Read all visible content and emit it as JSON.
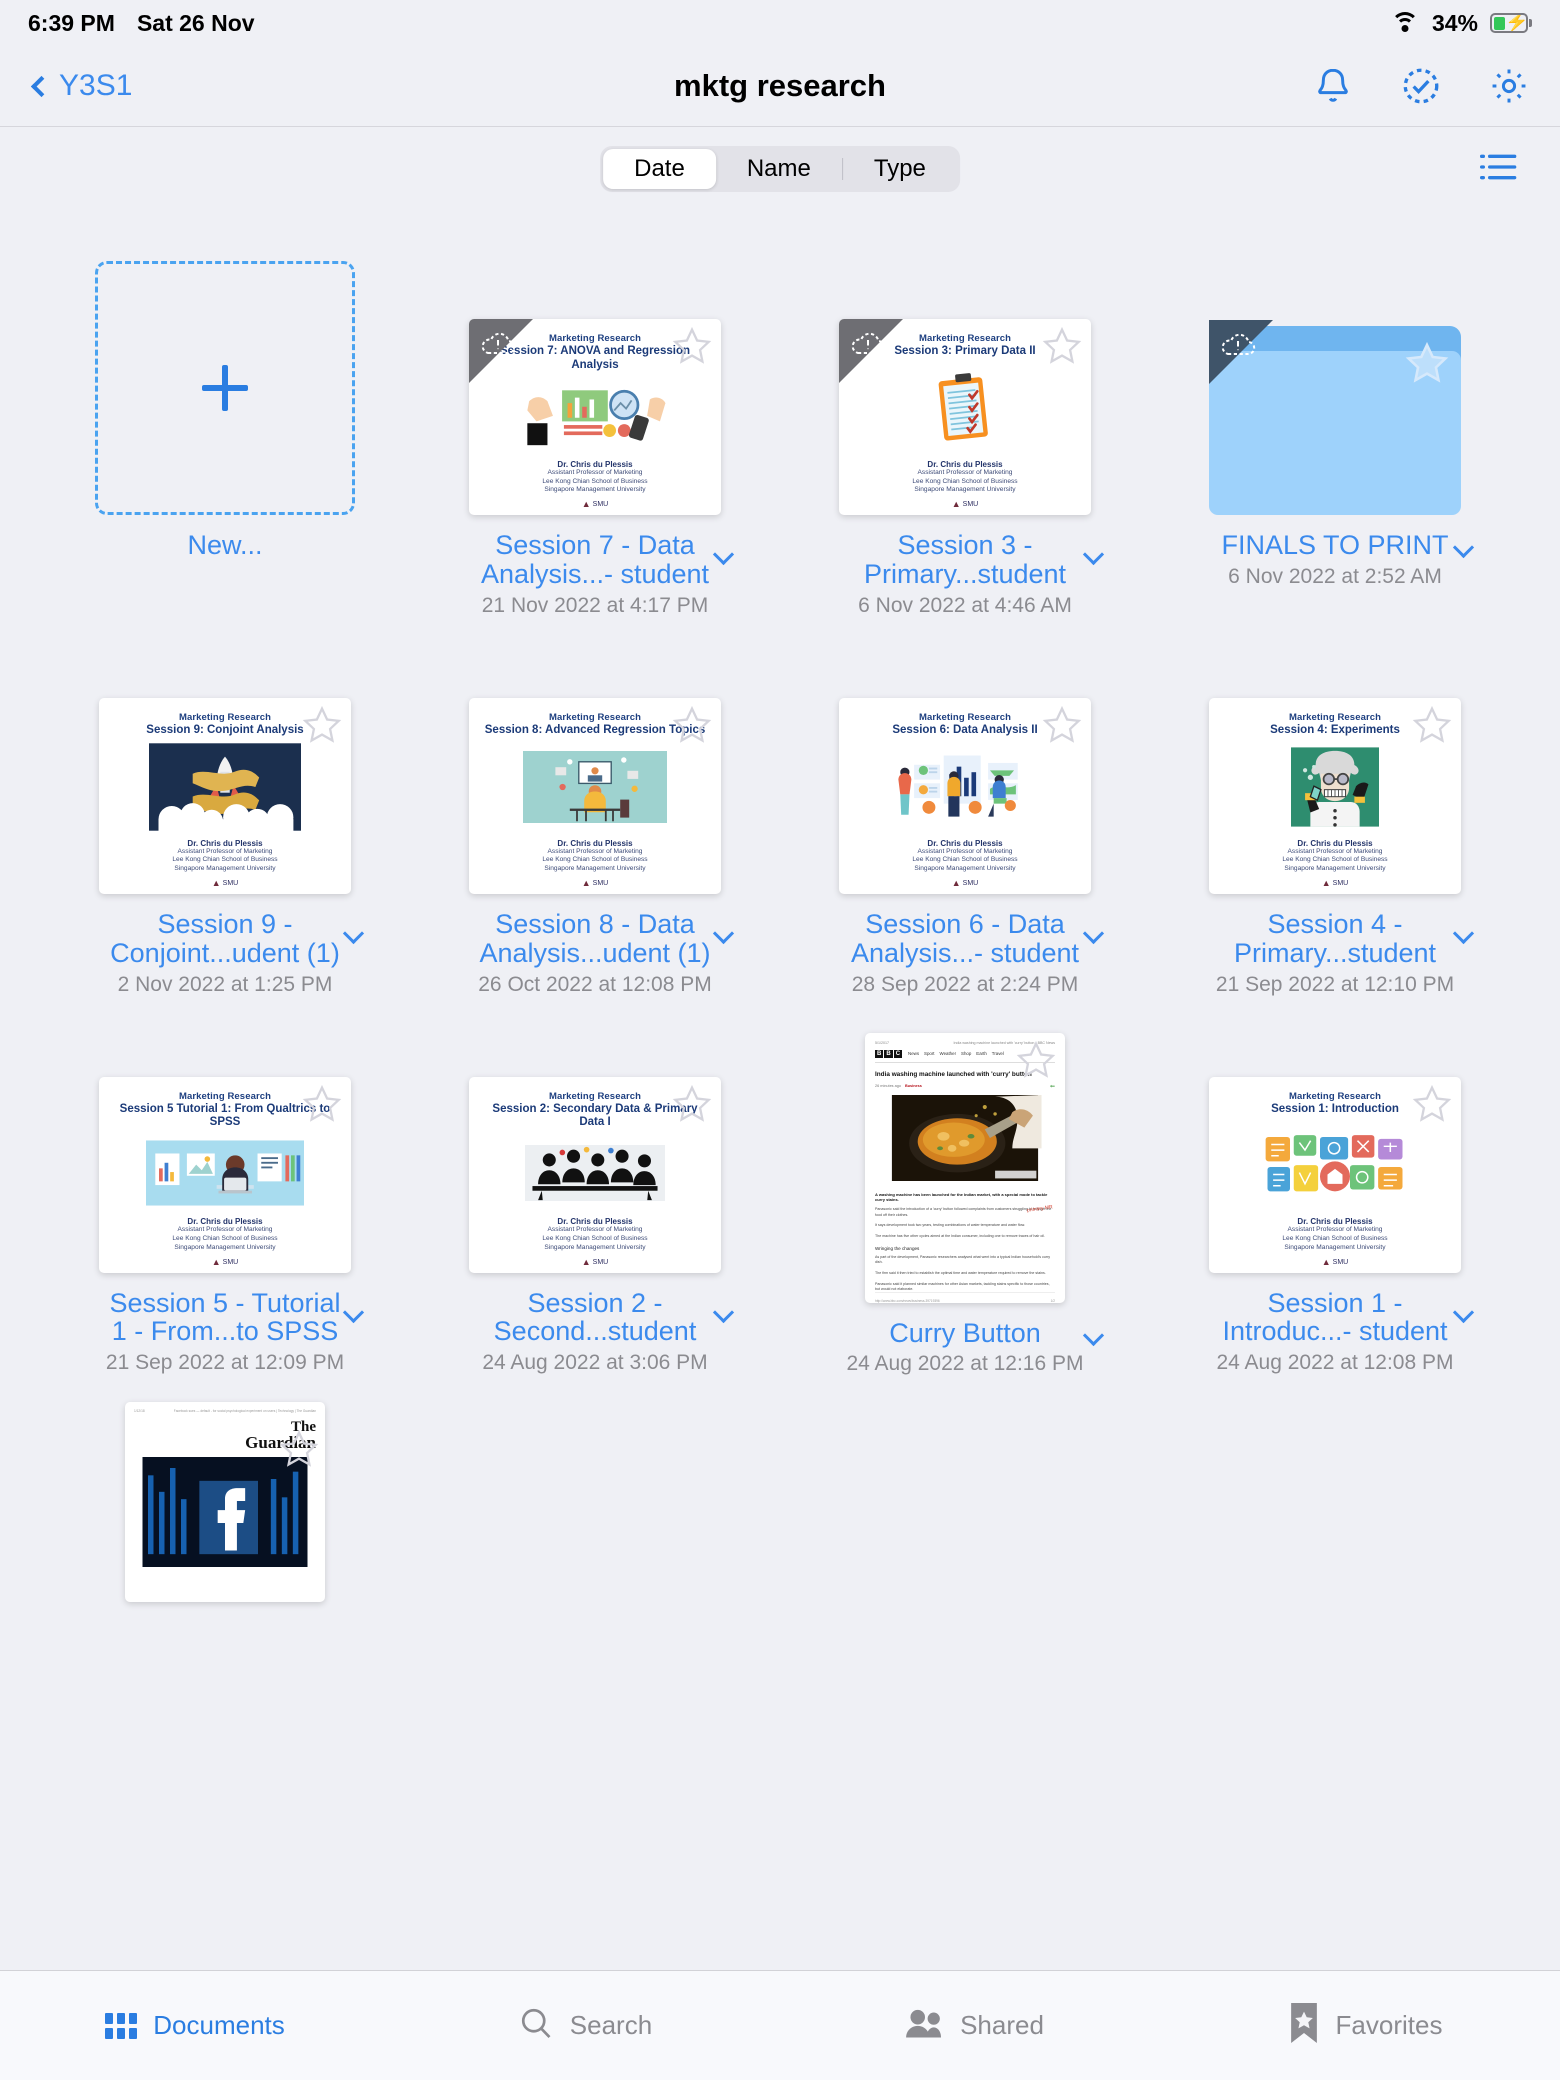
{
  "status_bar": {
    "time": "6:39 PM",
    "date": "Sat 26 Nov",
    "battery_percent": "34%",
    "wifi_icon": "wifi-icon",
    "battery_icon": "battery-charging-icon"
  },
  "nav": {
    "back_label": "Y3S1",
    "title": "mktg research",
    "actions": [
      {
        "name": "notifications-bell-icon",
        "label": "bell-icon"
      },
      {
        "name": "select-items-icon",
        "label": "dashed-circle-check-icon"
      },
      {
        "name": "settings-gear-icon",
        "label": "gear-icon"
      }
    ]
  },
  "toolbar": {
    "sort_options": [
      {
        "label": "Date",
        "selected": true
      },
      {
        "label": "Name",
        "selected": false
      },
      {
        "label": "Type",
        "selected": false
      }
    ],
    "view_toggle_icon": "list-view-icon"
  },
  "new_tile": {
    "label": "New...",
    "icon": "plus-icon"
  },
  "items": [
    {
      "name": "Session 7 - Data Analysis...- student",
      "date": "21 Nov 2022 at 4:17 PM",
      "kind": "presentation",
      "badge": "cloud-download-icon",
      "slide": {
        "subtitle": "Marketing Research",
        "title": "Session 7: ANOVA and Regression Analysis",
        "author": "Dr. Chris du Plessis",
        "affiliation_1": "Assistant Professor of Marketing",
        "affiliation_2": "Lee Kong Chian School of Business",
        "affiliation_3": "Singapore Management University",
        "logo": "SMU"
      }
    },
    {
      "name": "Session 3 - Primary...student",
      "date": "6 Nov 2022 at 4:46 AM",
      "kind": "presentation",
      "badge": "cloud-download-icon",
      "slide": {
        "subtitle": "Marketing Research",
        "title": "Session 3: Primary Data II",
        "author": "Dr. Chris du Plessis",
        "affiliation_1": "Assistant Professor of Marketing",
        "affiliation_2": "Lee Kong Chian School of Business",
        "affiliation_3": "Singapore Management University",
        "logo": "SMU"
      }
    },
    {
      "name": "FINALS TO PRINT",
      "date": "6 Nov 2022 at 2:52 AM",
      "kind": "folder",
      "badge": "cloud-download-icon"
    },
    {
      "name": "Session 9 - Conjoint...udent (1)",
      "date": "2 Nov 2022 at 1:25 PM",
      "kind": "presentation",
      "slide": {
        "subtitle": "Marketing Research",
        "title": "Session 9: Conjoint Analysis",
        "author": "Dr. Chris du Plessis",
        "affiliation_1": "Assistant Professor of Marketing",
        "affiliation_2": "Lee Kong Chian School of Business",
        "affiliation_3": "Singapore Management University",
        "logo": "SMU"
      }
    },
    {
      "name": "Session 8 - Data Analysis...udent (1)",
      "date": "26 Oct 2022 at 12:08 PM",
      "kind": "presentation",
      "slide": {
        "subtitle": "Marketing Research",
        "title": "Session 8: Advanced Regression Topics",
        "author": "Dr. Chris du Plessis",
        "affiliation_1": "Assistant Professor of Marketing",
        "affiliation_2": "Lee Kong Chian School of Business",
        "affiliation_3": "Singapore Management University",
        "logo": "SMU"
      }
    },
    {
      "name": "Session 6 - Data Analysis...- student",
      "date": "28 Sep 2022 at 2:24 PM",
      "kind": "presentation",
      "slide": {
        "subtitle": "Marketing Research",
        "title": "Session 6: Data Analysis II",
        "author": "Dr. Chris du Plessis",
        "affiliation_1": "Assistant Professor of Marketing",
        "affiliation_2": "Lee Kong Chian School of Business",
        "affiliation_3": "Singapore Management University",
        "logo": "SMU"
      }
    },
    {
      "name": "Session 4 - Primary...student",
      "date": "21 Sep 2022 at 12:10 PM",
      "kind": "presentation",
      "slide": {
        "subtitle": "Marketing Research",
        "title": "Session 4: Experiments",
        "author": "Dr. Chris du Plessis",
        "affiliation_1": "Assistant Professor of Marketing",
        "affiliation_2": "Lee Kong Chian School of Business",
        "affiliation_3": "Singapore Management University",
        "logo": "SMU"
      }
    },
    {
      "name": "Session 5 - Tutorial 1 - From...to SPSS",
      "date": "21 Sep 2022 at 12:09 PM",
      "kind": "presentation",
      "slide": {
        "subtitle": "Marketing Research",
        "title": "Session 5 Tutorial 1: From Qualtrics to SPSS",
        "author": "Dr. Chris du Plessis",
        "affiliation_1": "Assistant Professor of Marketing",
        "affiliation_2": "Lee Kong Chian School of Business",
        "affiliation_3": "Singapore Management University",
        "logo": "SMU"
      }
    },
    {
      "name": "Session 2 - Second...student",
      "date": "24 Aug 2022 at 3:06 PM",
      "kind": "presentation",
      "slide": {
        "subtitle": "Marketing Research",
        "title": "Session 2: Secondary Data & Primary Data I",
        "author": "Dr. Chris du Plessis",
        "affiliation_1": "Assistant Professor of Marketing",
        "affiliation_2": "Lee Kong Chian School of Business",
        "affiliation_3": "Singapore Management University",
        "logo": "SMU"
      }
    },
    {
      "name": "Curry Button",
      "date": "24 Aug 2022 at 12:16 PM",
      "kind": "article",
      "article": {
        "source": "BBC",
        "nav": [
          "News",
          "Sport",
          "Weather",
          "Shop",
          "Earth",
          "Travel"
        ],
        "headline": "India washing machine launched with 'curry' button",
        "byline": "26 minutes ago",
        "section": "Business",
        "lead": "A washing machine has been launched for the Indian market, with a special mode to tackle curry stains.",
        "subheading": "Wringing the changes"
      }
    },
    {
      "name": "Session 1 - Introduc...- student",
      "date": "24 Aug 2022 at 12:08 PM",
      "kind": "presentation",
      "slide": {
        "subtitle": "Marketing Research",
        "title": "Session 1: Introduction",
        "author": "Dr. Chris du Plessis",
        "affiliation_1": "Assistant Professor of Marketing",
        "affiliation_2": "Lee Kong Chian School of Business",
        "affiliation_3": "Singapore Management University",
        "logo": "SMU"
      }
    },
    {
      "name": "",
      "date": "",
      "kind": "article",
      "article": {
        "source": "The Guardian",
        "headline": ""
      }
    }
  ],
  "tabbar": [
    {
      "label": "Documents",
      "icon": "documents-grid-icon",
      "active": true
    },
    {
      "label": "Search",
      "icon": "search-icon",
      "active": false
    },
    {
      "label": "Shared",
      "icon": "shared-people-icon",
      "active": false
    },
    {
      "label": "Favorites",
      "icon": "star-bookmark-icon",
      "active": false
    }
  ],
  "colors": {
    "accent": "#2a7de1",
    "link": "#3b8aed",
    "background": "#eff0f5",
    "folder": "#9ed2fb",
    "battery_fill": "#34c759"
  }
}
